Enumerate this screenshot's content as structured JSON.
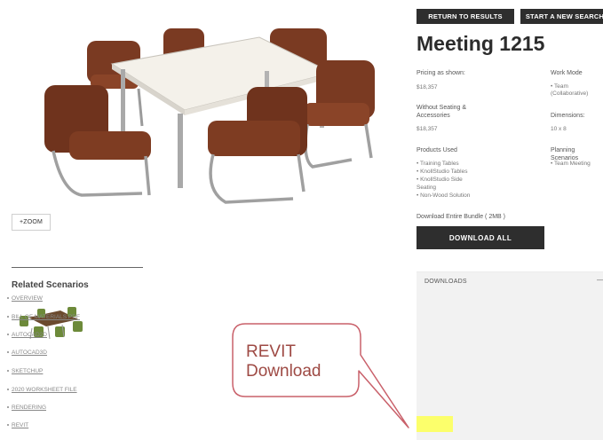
{
  "nav": {
    "return_label": "RETURN TO RESULTS",
    "start_label": "START A NEW SEARCH"
  },
  "product": {
    "title": "Meeting 1215",
    "zoom_label": "+ZOOM",
    "pricing_label": "Pricing as shown:",
    "pricing_value": "$18,357",
    "without_seating_label_1": "Without Seating &",
    "without_seating_label_2": "Accessories",
    "without_seating_value": "$18,357",
    "products_used_label": "Products Used",
    "products_used": [
      "• Training Tables",
      "• KnollStudio Tables",
      "• KnollStudio Side",
      "Seating",
      "• Non-Wood Solution"
    ],
    "work_mode_label": "Work Mode",
    "work_mode_value_1": "• Team",
    "work_mode_value_2": "(Collaborative)",
    "dimensions_label": "Dimensions:",
    "dimensions_value": "10 x 8",
    "planning_label": "Planning Scenarios",
    "planning_value": "• Team Meeting",
    "bundle_label": "Download Entire Bundle ( 2MB )",
    "download_all_label": "DOWNLOAD ALL"
  },
  "related": {
    "title": "Related Scenarios"
  },
  "downloads": {
    "header": "DOWNLOADS",
    "collapse": "—",
    "items": [
      "OVERVIEW",
      "BILL OF MATERIALS PDF",
      "AUTOCAD2D",
      "AUTOCAD3D",
      "SKETCHUP",
      "2020 WORKSHEET FILE",
      "RENDERING",
      "REVIT"
    ]
  },
  "annotation": {
    "line1": "REVIT",
    "line2": "Download"
  },
  "colors": {
    "dark_button": "#2e2e2e",
    "chair_leather": "#7a3a22",
    "callout_stroke": "#c9606a",
    "callout_text": "#9e4a44",
    "highlight": "#fcff6b"
  }
}
